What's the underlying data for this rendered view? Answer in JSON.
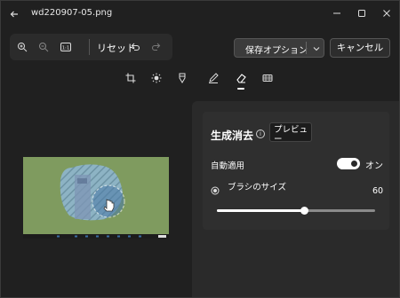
{
  "window": {
    "title": "wd220907-05.png"
  },
  "toolbar": {
    "reset_label": "リセット"
  },
  "actions": {
    "save_options_label": "保存オプション",
    "cancel_label": "キャンセル"
  },
  "modes": [
    "crop-icon",
    "brightness-icon",
    "markup-icon",
    "draw-icon",
    "erase-icon",
    "filter-icon"
  ],
  "panel": {
    "title": "生成消去",
    "preview_label": "プレビュー",
    "auto_apply_label": "自動適用",
    "toggle_state": "オン",
    "toggle_on": true,
    "brush_label": "ブラシのサイズ",
    "brush_size": "60",
    "brush_fraction": 0.55
  },
  "colors": {
    "accent": "#ffffff",
    "background": "#202020",
    "panel": "#2a2a2a",
    "preview_green": "#7f9b5f"
  }
}
